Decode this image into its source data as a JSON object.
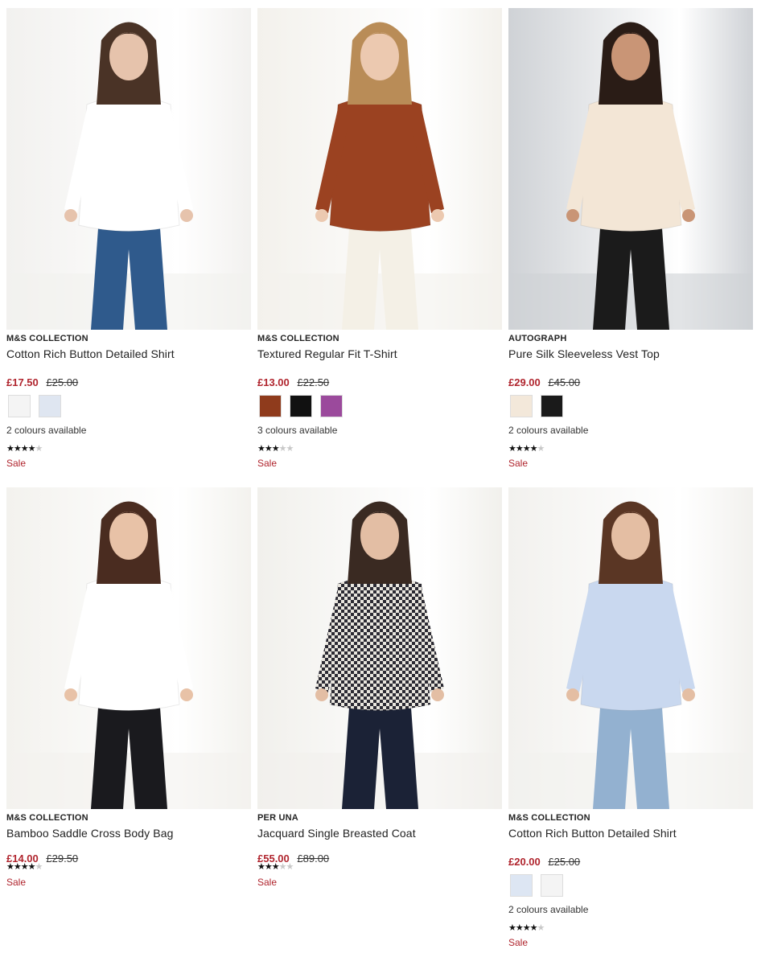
{
  "products": [
    {
      "brand": "M&S COLLECTION",
      "name": "Cotton Rich Button Detailed Shirt",
      "price_now": "£17.50",
      "price_was": "£25.00",
      "swatches": [
        "#f4f4f4",
        "#dfe6f1"
      ],
      "colours": "2 colours available",
      "rating": 4,
      "sale": "Sale",
      "image": {
        "bg": "#f2f1ef",
        "top": "#ffffff",
        "bottom": "#2f5a8c",
        "hair": "#4a3326",
        "skin": "#e6c3ac"
      }
    },
    {
      "brand": "M&S COLLECTION",
      "name": "Textured Regular Fit T-Shirt",
      "price_now": "£13.00",
      "price_was": "£22.50",
      "swatches": [
        "#8f3b1c",
        "#111111",
        "#9b4a9c"
      ],
      "colours": "3 colours available",
      "rating": 3.5,
      "sale": "Sale",
      "image": {
        "bg": "#f3f1ec",
        "top": "#9b4221",
        "bottom": "#f4f0e6",
        "hair": "#b98c57",
        "skin": "#ecc9b0"
      }
    },
    {
      "brand": "AUTOGRAPH",
      "name": "Pure Silk Sleeveless Vest Top",
      "price_now": "£29.00",
      "price_was": "£45.00",
      "swatches": [
        "#f3e8da",
        "#1a1a1a"
      ],
      "colours": "2 colours available",
      "rating": 4,
      "sale": "Sale",
      "image": {
        "bg": "#cfd2d6",
        "top": "#f3e6d6",
        "bottom": "#1b1b1b",
        "hair": "#2a1c16",
        "skin": "#c99576"
      }
    },
    {
      "brand": "M&S COLLECTION",
      "name": "Bamboo Saddle Cross Body Bag",
      "price_now": "£14.00",
      "price_was": "£29.50",
      "rating": 4,
      "sale": "Sale",
      "image": {
        "bg": "#f3f2ee",
        "top": "#ffffff",
        "bottom": "#1a1a1e",
        "hair": "#4a2c20",
        "skin": "#e8c2a7"
      }
    },
    {
      "brand": "PER UNA",
      "name": "Jacquard Single Breasted Coat",
      "price_now": "£55.00",
      "price_was": "£89.00",
      "rating": 3.5,
      "sale": "Sale",
      "image": {
        "bg": "#f1f0ec",
        "top": "#6c6b73",
        "bottom": "#1b2236",
        "hair": "#3a2a22",
        "skin": "#e3bea4"
      }
    },
    {
      "brand": "M&S COLLECTION",
      "name": "Cotton Rich Button Detailed Shirt",
      "price_now": "£20.00",
      "price_was": "£25.00",
      "swatches": [
        "#dde6f3",
        "#f4f4f4"
      ],
      "colours": "2 colours available",
      "rating": 4,
      "sale": "Sale",
      "image": {
        "bg": "#f2f1ee",
        "top": "#c9d8ef",
        "bottom": "#93b1d0",
        "hair": "#5a3624",
        "skin": "#e4bea3"
      }
    }
  ]
}
